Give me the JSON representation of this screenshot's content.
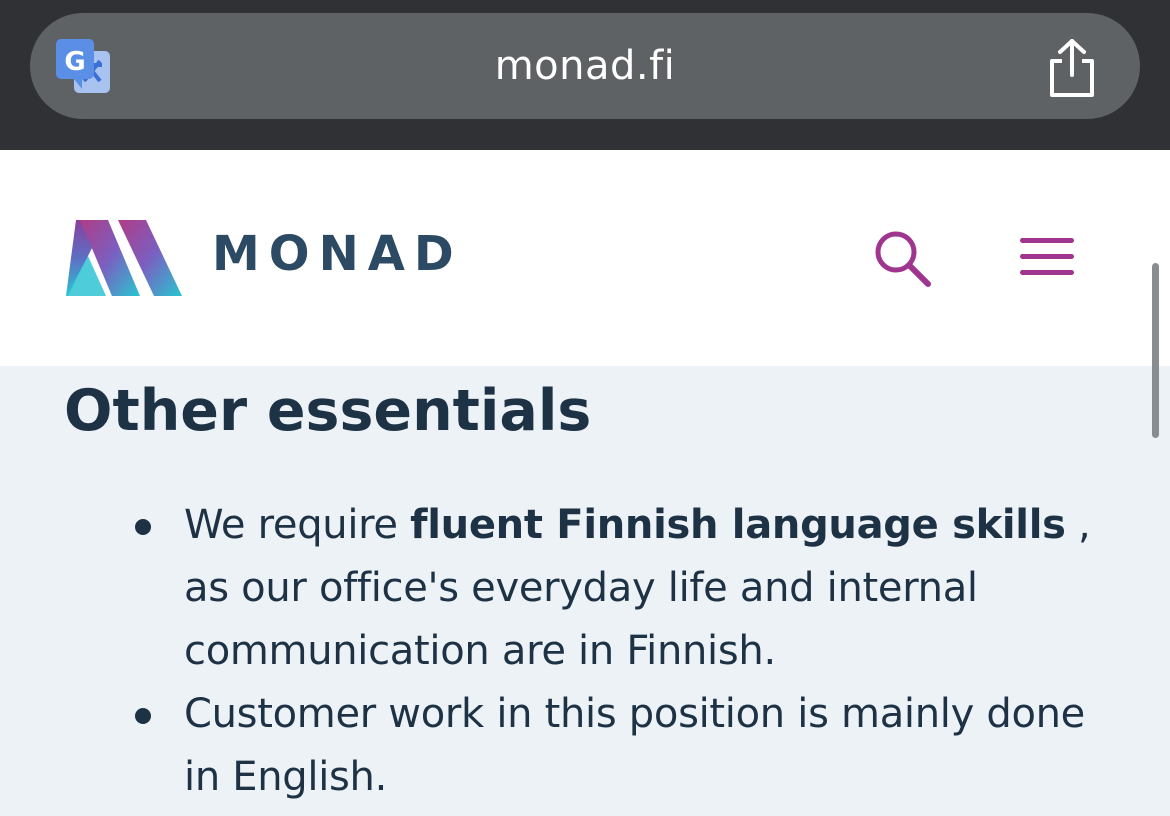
{
  "browser": {
    "url": "monad.fi",
    "translate_icon": "google-translate-icon",
    "share_icon": "share-icon"
  },
  "header": {
    "logo_text": "MONAD",
    "search_icon": "search-icon",
    "menu_icon": "hamburger-menu-icon",
    "accent_color": "#a0358f",
    "logo_text_color": "#2d4a64"
  },
  "content": {
    "title": "Other essentials",
    "bullets": [
      {
        "prefix": "We require ",
        "bold": "fluent Finnish language skills",
        "suffix": " , as our office's everyday life and internal communication are in Finnish."
      },
      {
        "text": "Customer work in this position is mainly done in English."
      }
    ]
  }
}
